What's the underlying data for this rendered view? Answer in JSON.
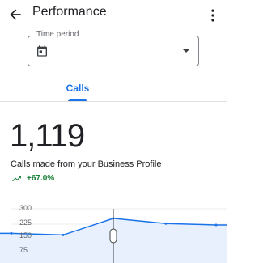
{
  "appbar": {
    "title": "Performance",
    "back_icon": "arrow-back-icon",
    "menu_icon": "more-vert-icon"
  },
  "time_period": {
    "label": "Time period",
    "value": "",
    "icon": "calendar-icon",
    "dropdown_icon": "dropdown-arrow-icon"
  },
  "tabs": [
    {
      "label": "Calls",
      "selected": true
    }
  ],
  "metric": {
    "value": "1,119",
    "caption": "Calls made from your Business Profile",
    "trend_icon": "trending-up-icon",
    "trend_value": "+67.0%"
  },
  "colors": {
    "accent": "#1a73e8",
    "positive": "#188038",
    "line": "#1a73e8",
    "fill": "#e8f0fe"
  },
  "chart_data": {
    "type": "area",
    "y_ticks": [
      "300",
      "225",
      "150",
      "75"
    ],
    "ylim": [
      0,
      300
    ],
    "values": [
      180,
      172,
      253,
      228,
      221
    ],
    "selected_index": 2
  }
}
